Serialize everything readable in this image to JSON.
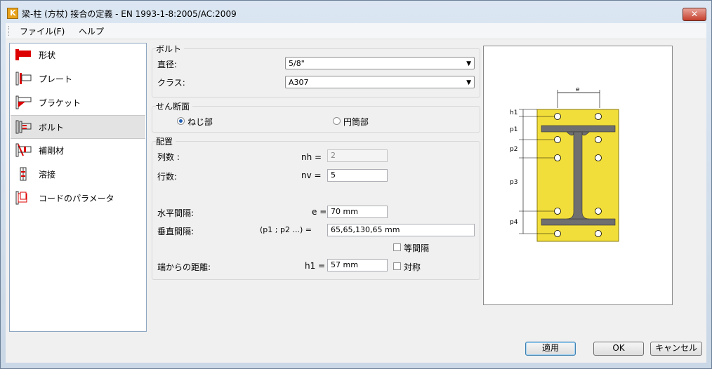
{
  "window": {
    "title": "梁-柱 (方杖) 接合の定義 - EN 1993-1-8:2005/AC:2009",
    "close_label": "✕",
    "app_icon_letter": "K"
  },
  "menu": {
    "items": [
      "ファイル(F)",
      "ヘルプ"
    ]
  },
  "nav": {
    "items": [
      {
        "label": "形状",
        "icon": "shape-icon"
      },
      {
        "label": "プレート",
        "icon": "plate-icon"
      },
      {
        "label": "ブラケット",
        "icon": "bracket-icon"
      },
      {
        "label": "ボルト",
        "icon": "bolt-icon"
      },
      {
        "label": "補剛材",
        "icon": "stiffener-icon"
      },
      {
        "label": "溶接",
        "icon": "weld-icon"
      },
      {
        "label": "コードのパラメータ",
        "icon": "code-parameters-icon"
      }
    ],
    "selected": "ボルト"
  },
  "bolt": {
    "title": "ボルト",
    "diameter_label": "直径:",
    "diameter_value": "5/8\"",
    "class_label": "クラス:",
    "class_value": "A307"
  },
  "shear": {
    "title": "せん断面",
    "thread_label": "ねじ部",
    "shank_label": "円筒部",
    "selected": "ねじ部"
  },
  "layout": {
    "title": "配置",
    "columns_label": "列数 :",
    "columns_symbol": "nh =",
    "columns_value": "2",
    "rows_label": "行数:",
    "rows_symbol": "nv =",
    "rows_value": "5",
    "horizontal_label": "水平間隔:",
    "horizontal_symbol": "e =",
    "horizontal_value": "70 mm",
    "vertical_label": "垂直間隔:",
    "vertical_symbol": "(p1 ; p2 ...) =",
    "vertical_value": "65,65,130,65 mm",
    "equal_spacing_label": "等間隔",
    "equal_spacing_checked": false,
    "edge_label": "端からの距離:",
    "edge_symbol": "h1 =",
    "edge_value": "57 mm",
    "symmetric_label": "対称",
    "symmetric_checked": false
  },
  "preview": {
    "labels": {
      "e": "e",
      "h1": "h1",
      "p1": "p1",
      "p2": "p2",
      "p3": "p3",
      "p4": "p4"
    },
    "plate_color": "#f2de3a",
    "beam_color": "#6f6f6f"
  },
  "buttons": {
    "apply": "適用",
    "ok": "OK",
    "cancel": "キャンセル"
  }
}
